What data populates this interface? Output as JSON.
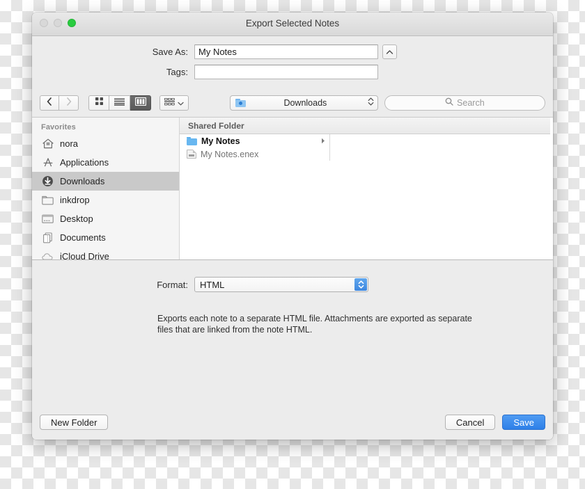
{
  "window": {
    "title": "Export Selected Notes",
    "traffic_lights": [
      "close-disabled",
      "minimize-disabled",
      "zoom-green"
    ],
    "accent_blue": "#3b8ef0",
    "selection_grey": "#c9c9c9"
  },
  "save_fields": {
    "save_as_label": "Save As:",
    "save_as_value": "My Notes",
    "tags_label": "Tags:",
    "tags_value": "",
    "tags_placeholder": "",
    "disclosure_icon": "chevron-up-icon"
  },
  "toolbar": {
    "back_icon": "chevron-left-icon",
    "forward_icon": "chevron-right-icon",
    "views": [
      {
        "name": "icon-view",
        "icon": "grid-icon",
        "selected": false
      },
      {
        "name": "list-view",
        "icon": "lines-icon",
        "selected": false
      },
      {
        "name": "column-view",
        "icon": "columns-icon",
        "selected": true
      }
    ],
    "arrange_icon": "arrange-grid-icon",
    "arrange_chevron": "chevron-down-icon",
    "path_popup": {
      "icon": "blue-folder-icon",
      "label": "Downloads",
      "stepper_icon": "up-down-chevron-icon"
    },
    "search": {
      "icon": "search-icon",
      "placeholder": "Search",
      "value": ""
    }
  },
  "sidebar": {
    "header": "Favorites",
    "items": [
      {
        "label": "nora",
        "icon": "home-icon",
        "selected": false
      },
      {
        "label": "Applications",
        "icon": "appstore-a-icon",
        "selected": false
      },
      {
        "label": "Downloads",
        "icon": "download-icon",
        "selected": true
      },
      {
        "label": "inkdrop",
        "icon": "folder-icon",
        "selected": false
      },
      {
        "label": "Desktop",
        "icon": "desktop-icon",
        "selected": false
      },
      {
        "label": "Documents",
        "icon": "documents-icon",
        "selected": false
      },
      {
        "label": "iCloud Drive",
        "icon": "cloud-icon",
        "selected": false
      }
    ]
  },
  "file_browser": {
    "column_header": "Shared Folder",
    "rows": [
      {
        "name": "My Notes",
        "kind": "folder",
        "icon": "blue-folder-icon",
        "has_children": true,
        "chevron": "chevron-right-icon"
      },
      {
        "name": "My Notes.enex",
        "kind": "file",
        "icon": "document-icon",
        "has_children": false,
        "chevron": ""
      }
    ]
  },
  "format_panel": {
    "label": "Format:",
    "selected": "HTML",
    "options": [
      "HTML"
    ],
    "stepper_icon": "up-down-chevron-icon",
    "description": "Exports each note to a separate HTML file.  Attachments are exported as separate files that are linked from the note HTML."
  },
  "footer": {
    "new_folder_label": "New Folder",
    "cancel_label": "Cancel",
    "save_label": "Save"
  }
}
